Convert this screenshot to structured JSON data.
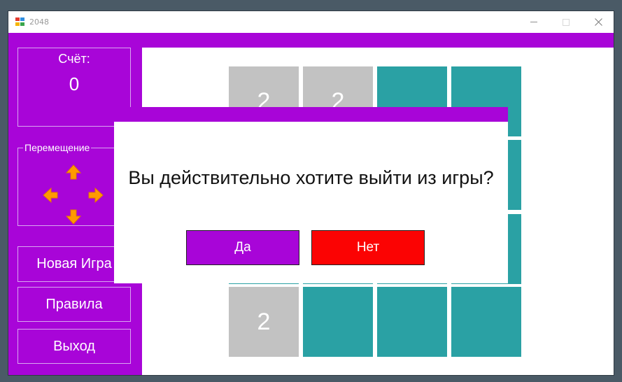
{
  "window": {
    "title": "2048"
  },
  "score": {
    "label": "Счёт:",
    "value": "0"
  },
  "movement": {
    "legend": "Перемещение",
    "arrows": [
      "arrow-up-icon",
      "arrow-left-icon",
      "arrow-right-icon",
      "arrow-down-icon"
    ]
  },
  "menu": {
    "new_game": "Новая Игра",
    "rules": "Правила",
    "exit": "Выход"
  },
  "board": {
    "rows": [
      [
        "2",
        "2",
        "",
        ""
      ],
      [
        "",
        "",
        "",
        ""
      ],
      [
        "",
        "",
        "",
        ""
      ],
      [
        "2",
        "",
        "",
        ""
      ]
    ]
  },
  "dialog": {
    "message": "Вы действительно хотите выйти из игры?",
    "yes": "Да",
    "no": "Нет"
  },
  "colors": {
    "accent": "#a805d8",
    "tile_filled": "#c2c2c2",
    "tile_empty": "#2aa1a4",
    "arrow": "#ff9a00",
    "no_button": "#fb0303"
  }
}
